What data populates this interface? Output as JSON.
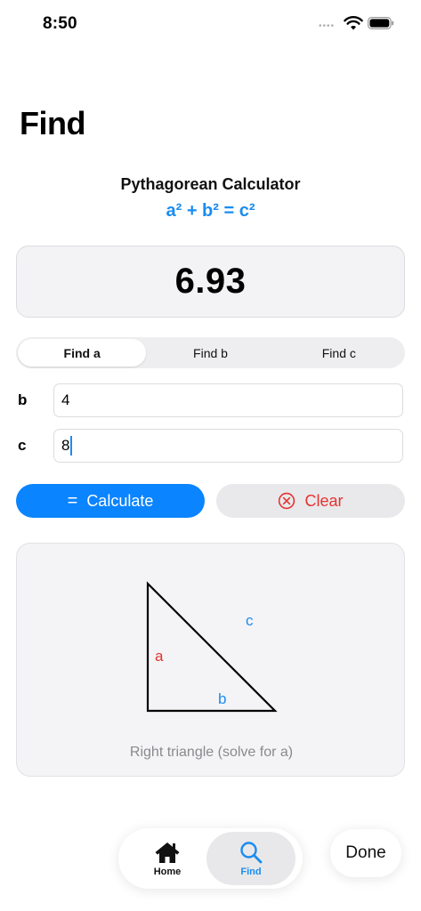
{
  "status_bar": {
    "time": "8:50",
    "dots": "••••"
  },
  "page": {
    "title": "Find"
  },
  "calculator": {
    "title": "Pythagorean Calculator",
    "formula": "a² + b² = c²",
    "result": "6.93"
  },
  "segments": [
    {
      "label": "Find a",
      "selected": true
    },
    {
      "label": "Find b",
      "selected": false
    },
    {
      "label": "Find c",
      "selected": false
    }
  ],
  "fields": {
    "b": {
      "label": "b",
      "value": "4"
    },
    "c": {
      "label": "c",
      "value": "8"
    }
  },
  "buttons": {
    "calculate": {
      "label": "Calculate",
      "icon": "="
    },
    "clear": {
      "label": "Clear",
      "icon": "ⓧ"
    }
  },
  "triangle": {
    "side_a": "a",
    "side_b": "b",
    "side_c": "c",
    "caption": "Right triangle (solve for a)"
  },
  "tab_bar": {
    "home_label": "Home",
    "find_label": "Find"
  },
  "done_label": "Done",
  "colors": {
    "accent": "#0a84ff",
    "formula": "#1a8cf0",
    "side_a": "#e5332f",
    "destructive": "#e5332f"
  }
}
